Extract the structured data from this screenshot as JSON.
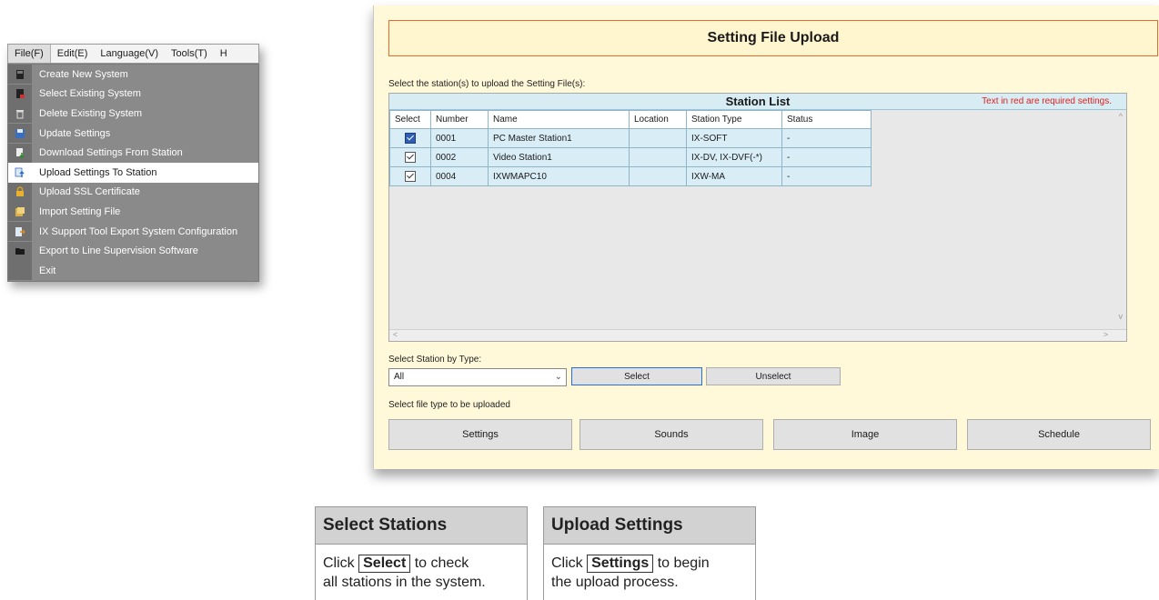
{
  "menubar": {
    "items": [
      "File(F)",
      "Edit(E)",
      "Language(V)",
      "Tools(T)",
      "H"
    ]
  },
  "file_menu": {
    "items": [
      {
        "label": "Create New System",
        "icon": "new-system-icon"
      },
      {
        "label": "Select Existing System",
        "icon": "select-system-icon"
      },
      {
        "label": "Delete Existing System",
        "icon": "trash-icon"
      },
      {
        "label": "Update Settings",
        "icon": "save-icon"
      },
      {
        "label": "Download Settings From Station",
        "icon": "download-icon"
      },
      {
        "label": "Upload Settings To Station",
        "icon": "upload-icon",
        "highlighted": true
      },
      {
        "label": "Upload SSL Certificate",
        "icon": "lock-icon"
      },
      {
        "label": "Import Setting File",
        "icon": "import-icon"
      },
      {
        "label": "IX Support Tool Export System Configuration",
        "icon": "export-icon"
      },
      {
        "label": "Export to Line Supervision Software",
        "icon": "folder-icon"
      },
      {
        "label": "Exit",
        "icon": ""
      }
    ]
  },
  "upload_window": {
    "title": "Setting File Upload",
    "select_instruction": "Select the station(s) to upload the Setting File(s):",
    "station_list": {
      "title": "Station List",
      "required_note": "Text in red are required settings.",
      "columns": [
        "Select",
        "Number",
        "Name",
        "Location",
        "Station Type",
        "Status"
      ],
      "rows": [
        {
          "checked": true,
          "number": "0001",
          "name": "PC Master Station1",
          "location": "",
          "type": "IX-SOFT",
          "status": "-"
        },
        {
          "checked": true,
          "number": "0002",
          "name": "Video Station1",
          "location": "",
          "type": "IX-DV, IX-DVF(-*)",
          "status": "-"
        },
        {
          "checked": true,
          "number": "0004",
          "name": "IXWMAPC10",
          "location": "",
          "type": "IXW-MA",
          "status": "-"
        }
      ]
    },
    "select_by_type_label": "Select Station by Type:",
    "type_dropdown_value": "All",
    "select_button": "Select",
    "unselect_button": "Unselect",
    "file_type_label": "Select file type to be uploaded",
    "file_type_buttons": [
      "Settings",
      "Sounds",
      "Image",
      "Schedule"
    ],
    "scroll_glyphs": {
      "up": "^",
      "down": "v",
      "left": "<",
      "right": ">"
    }
  },
  "callouts": [
    {
      "title": "Select Stations",
      "prefix": "Click",
      "button": "Select",
      "suffix": "to check",
      "line2": "all stations in the system."
    },
    {
      "title": "Upload Settings",
      "prefix": "Click",
      "button": "Settings",
      "suffix": "to begin",
      "line2": "the upload process."
    }
  ],
  "colors": {
    "window_bg": "#fff9d9",
    "title_border": "#e46b2c",
    "required_red": "#e0201c",
    "list_header_bg": "#d8ecf4",
    "menu_bg": "#8a8a8a",
    "button_focus_border": "#2a6fd0"
  }
}
